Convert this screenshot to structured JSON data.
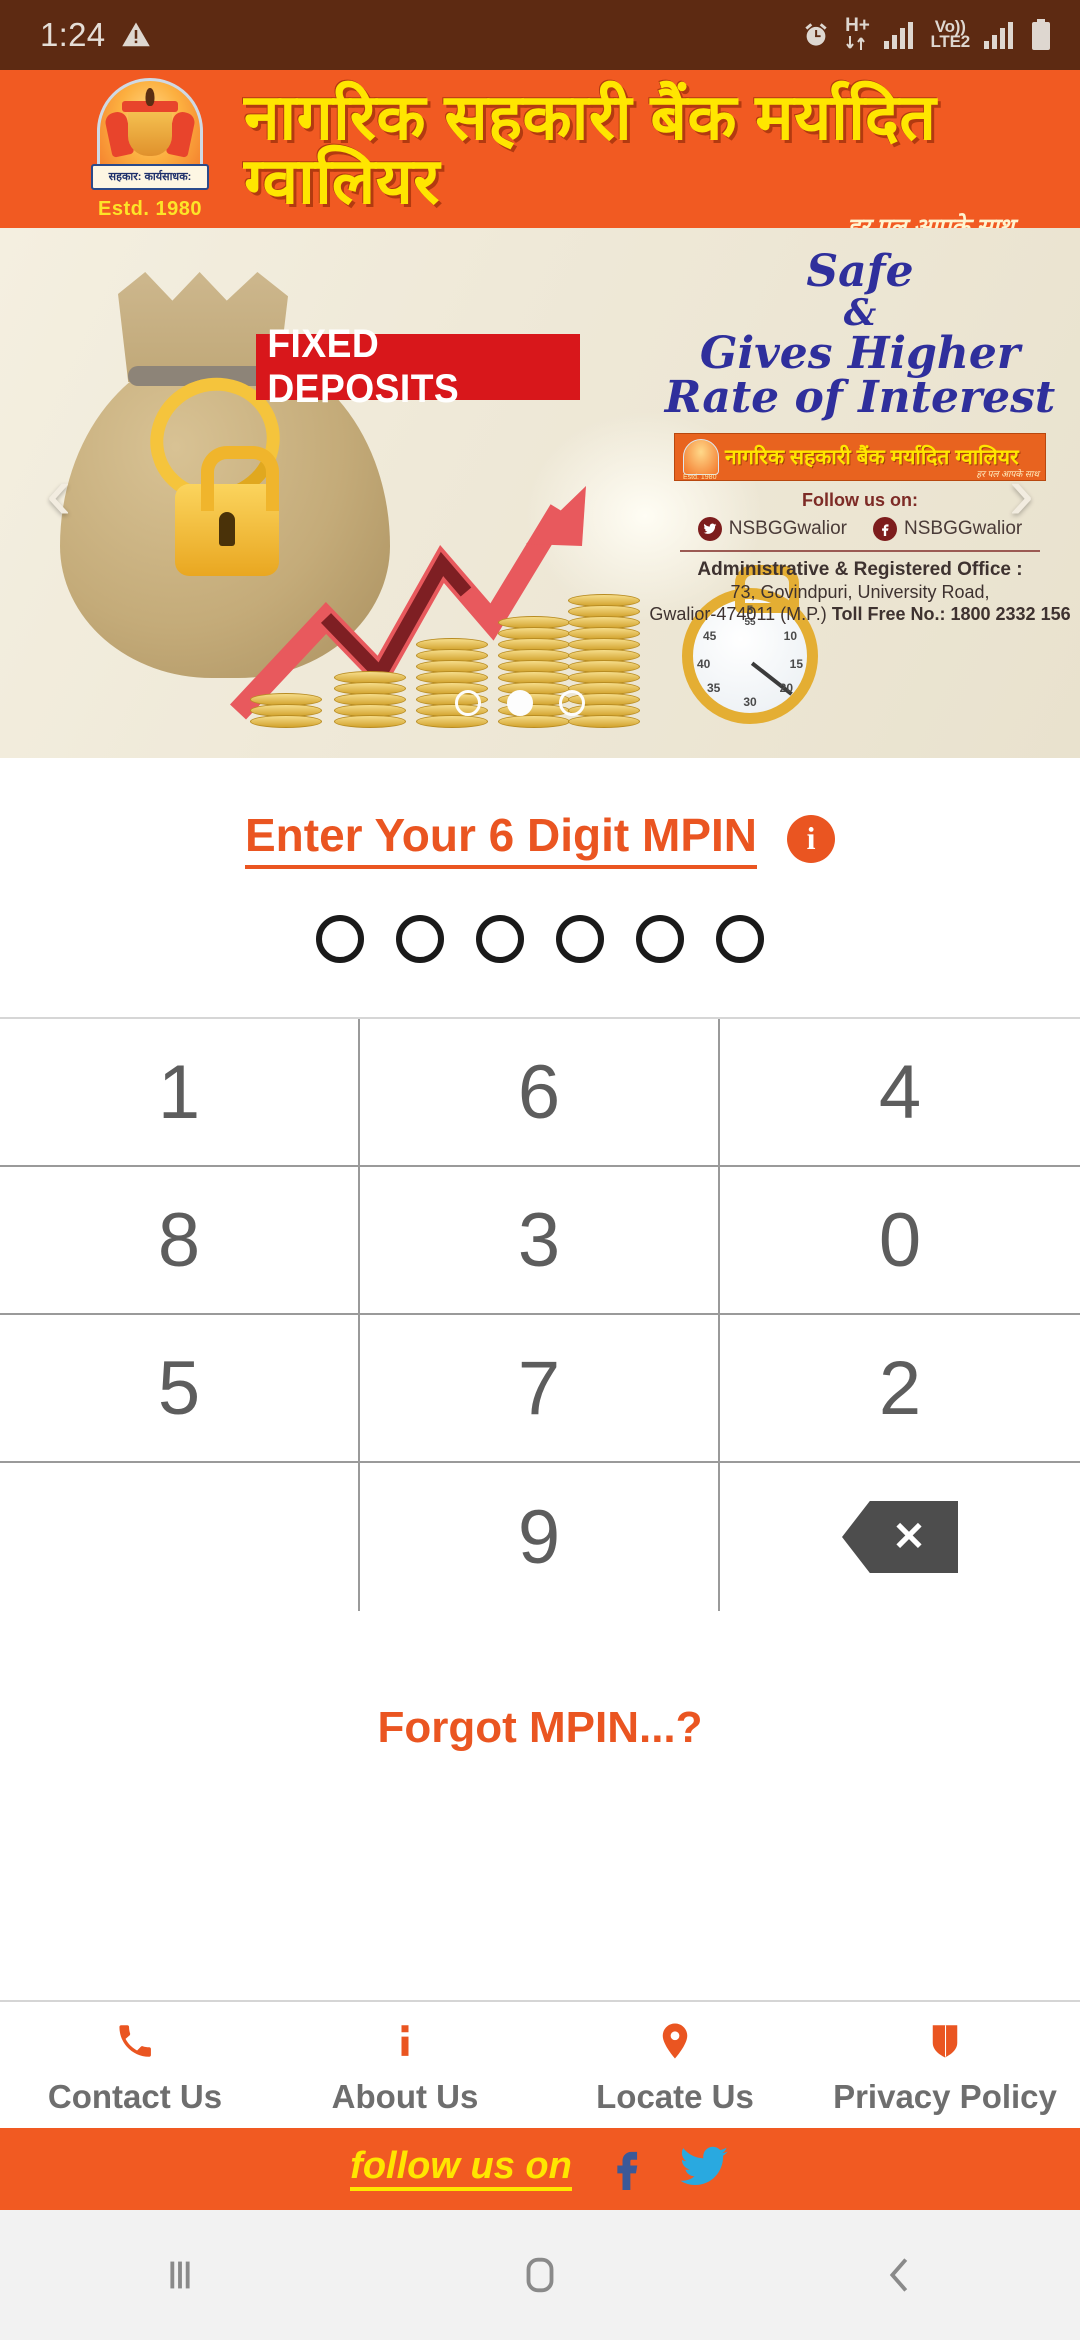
{
  "status_bar": {
    "time": "1:24",
    "warning_icon": "warning-triangle-icon",
    "alarm_icon": "alarm-clock-icon",
    "network_type": "H+",
    "volte_line1": "Vo))",
    "volte_line2": "LTE2",
    "battery_icon": "battery-icon"
  },
  "header": {
    "bank_name": "नागरिक सहकारी बैंक मर्यादित ग्वालियर",
    "tagline": "हर पल आपके साथ",
    "crest_motto": "सहकार: कार्यसाधक:",
    "established": "Estd. 1980"
  },
  "banner": {
    "product_label": "FIXED DEPOSITS",
    "promo_line1": "Safe",
    "promo_line2": "&",
    "promo_line3": "Gives Higher",
    "promo_line4": "Rate of Interest",
    "mini_logo_name": "नागरिक सहकारी बैंक मर्यादित ग्वालियर",
    "mini_logo_estd": "Estd. 1980",
    "mini_logo_tagline": "हर पल आपके साथ",
    "follow_heading": "Follow us on:",
    "twitter_handle": "NSBGGwalior",
    "facebook_handle": "NSBGGwalior",
    "office_heading": "Administrative & Registered Office :",
    "office_line1": "73, Govindpuri, University Road,",
    "office_line2_prefix": "Gwalior-474011 (M.P.) ",
    "office_line2_bold": "Toll Free No.: 1800 2332 156",
    "prev_arrow": "‹",
    "next_arrow": "›"
  },
  "mpin": {
    "title": "Enter Your 6 Digit MPIN",
    "info_icon_label": "i",
    "pin_length": 6,
    "filled_count": 0,
    "keypad": [
      [
        "1",
        "6",
        "4"
      ],
      [
        "8",
        "3",
        "0"
      ],
      [
        "5",
        "7",
        "2"
      ],
      [
        "",
        "9",
        "backspace"
      ]
    ],
    "backspace_glyph": "✕",
    "forgot_label": "Forgot MPIN...?"
  },
  "bottom_nav": [
    {
      "label": "Contact Us",
      "icon": "phone-icon"
    },
    {
      "label": "About Us",
      "icon": "info-icon"
    },
    {
      "label": "Locate Us",
      "icon": "map-pin-icon"
    },
    {
      "label": "Privacy Policy",
      "icon": "shield-icon"
    }
  ],
  "follow_bar": {
    "label": "follow us on",
    "facebook_icon": "facebook-icon",
    "twitter_icon": "twitter-icon"
  },
  "android_nav": {
    "recents": "recents-icon",
    "home": "home-icon",
    "back": "back-icon"
  },
  "colors": {
    "brand_orange": "#f15a22",
    "accent_orange": "#ea5521",
    "header_yellow": "#ffe600",
    "status_bg": "#5d2a12",
    "facebook_blue": "#3b5998",
    "twitter_blue": "#29a9e0"
  }
}
